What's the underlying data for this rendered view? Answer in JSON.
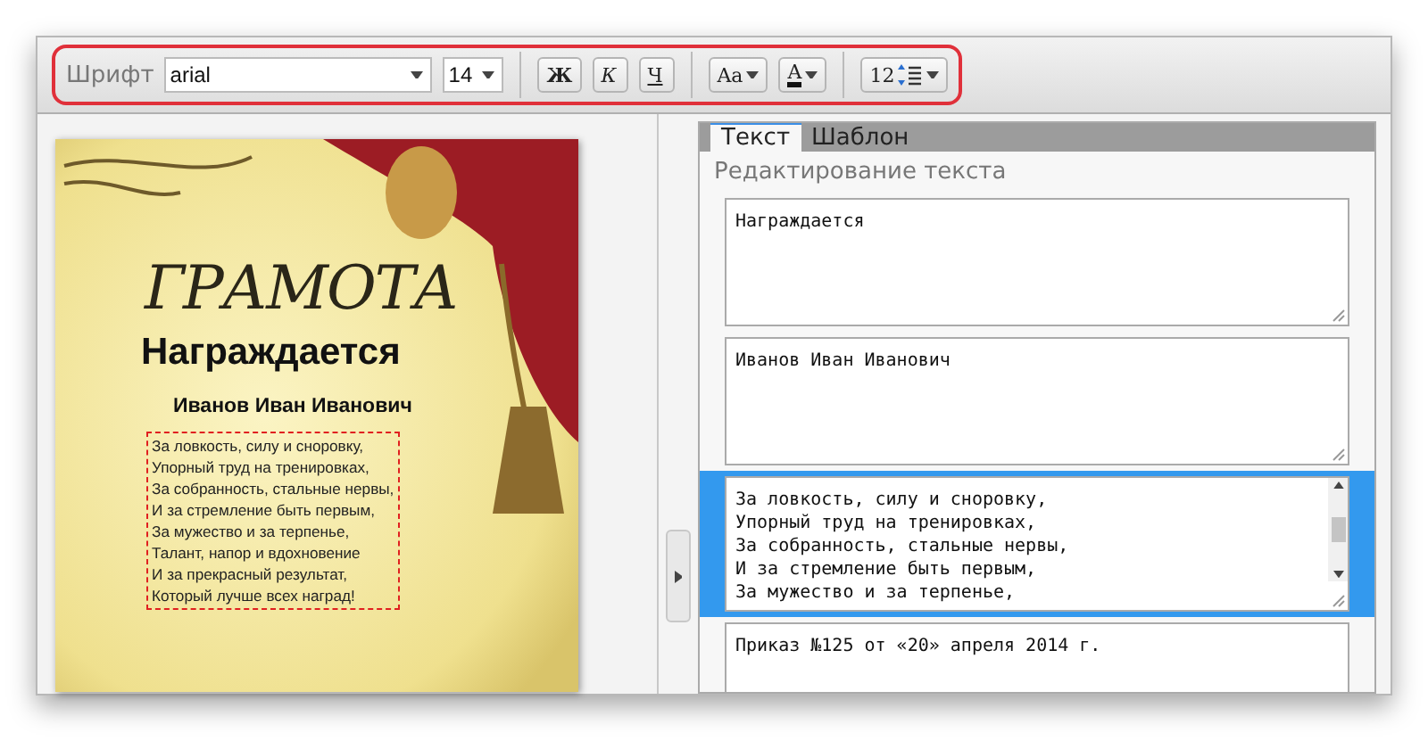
{
  "toolbar": {
    "font_label": "Шрифт",
    "font": "arial",
    "size": "14",
    "buttons": [
      {
        "kind": "bold",
        "label": "Ж"
      },
      {
        "kind": "italic",
        "label": "К"
      },
      {
        "kind": "underline",
        "label": "Ч"
      }
    ],
    "case_label": "Aa",
    "color_label": "A",
    "spacing_label": "12"
  },
  "certificate": {
    "title": "ГРАМОТА",
    "heading": "Награждается",
    "name": "Иванов Иван Иванович",
    "poem": [
      "За ловкость, силу и сноровку,",
      "Упорный труд на тренировках,",
      "За собранность, стальные нервы,",
      "И за стремление быть первым,",
      "За мужество и за терпенье,",
      "Талант, напор и вдохновение",
      "И за прекрасный результат,",
      "Который лучше всех наград!"
    ]
  },
  "tabs": [
    {
      "label": "Текст",
      "selected": true
    },
    {
      "label": "Шаблон",
      "selected": false
    }
  ],
  "editor": {
    "heading": "Редактирование текста",
    "fields": [
      {
        "lines": [
          "Награждается"
        ],
        "selected": false
      },
      {
        "lines": [
          "Иванов Иван Иванович"
        ],
        "selected": false
      },
      {
        "lines": [
          "За ловкость, силу и сноровку,",
          "Упорный труд на тренировках,",
          "За собранность, стальные нервы,",
          "И за стремление быть первым,",
          "За мужество и за терпенье,"
        ],
        "selected": true
      },
      {
        "lines": [
          "Приказ №125 от «20» апреля 2014 г."
        ],
        "selected": false
      }
    ]
  }
}
